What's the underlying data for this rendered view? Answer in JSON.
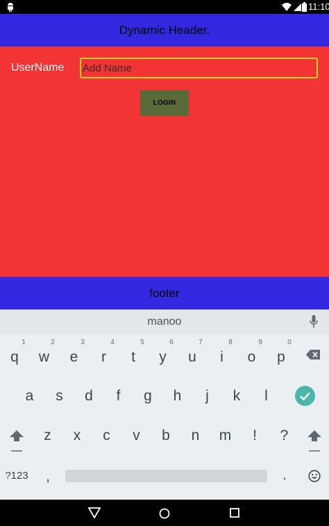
{
  "status_bar": {
    "time": "11:10"
  },
  "header": {
    "title": "Dynamic Header."
  },
  "form": {
    "username_label": "UserName",
    "username_placeholder": "Add Name",
    "login_label": "LOGIN"
  },
  "footer": {
    "text": "footer"
  },
  "keyboard": {
    "suggestion": "manoo",
    "row1": [
      {
        "key": "q",
        "hint": "1"
      },
      {
        "key": "w",
        "hint": "2"
      },
      {
        "key": "e",
        "hint": "3"
      },
      {
        "key": "r",
        "hint": "4"
      },
      {
        "key": "t",
        "hint": "5"
      },
      {
        "key": "y",
        "hint": "6"
      },
      {
        "key": "u",
        "hint": "7"
      },
      {
        "key": "i",
        "hint": "8"
      },
      {
        "key": "o",
        "hint": "9"
      },
      {
        "key": "p",
        "hint": "0"
      }
    ],
    "row2": [
      "a",
      "s",
      "d",
      "f",
      "g",
      "h",
      "j",
      "k",
      "l"
    ],
    "row3": [
      "z",
      "x",
      "c",
      "v",
      "b",
      "n",
      "m",
      "!",
      "?"
    ],
    "row4": {
      "symbols": "?123",
      "comma": ",",
      "period": "."
    }
  },
  "colors": {
    "header_bg": "#3429e0",
    "content_bg": "#f23434",
    "input_border": "#c7d430",
    "login_bg": "#5a6b3a",
    "enter_key": "#4db6ac"
  },
  "icons": {
    "status": [
      "android-icon",
      "wifi-icon",
      "signal-icon",
      "battery-icon"
    ],
    "keyboard": [
      "mic-icon",
      "backspace-icon",
      "enter-check-icon",
      "shift-icon",
      "emoji-icon"
    ],
    "nav": [
      "back-icon",
      "home-icon",
      "recents-icon"
    ]
  }
}
